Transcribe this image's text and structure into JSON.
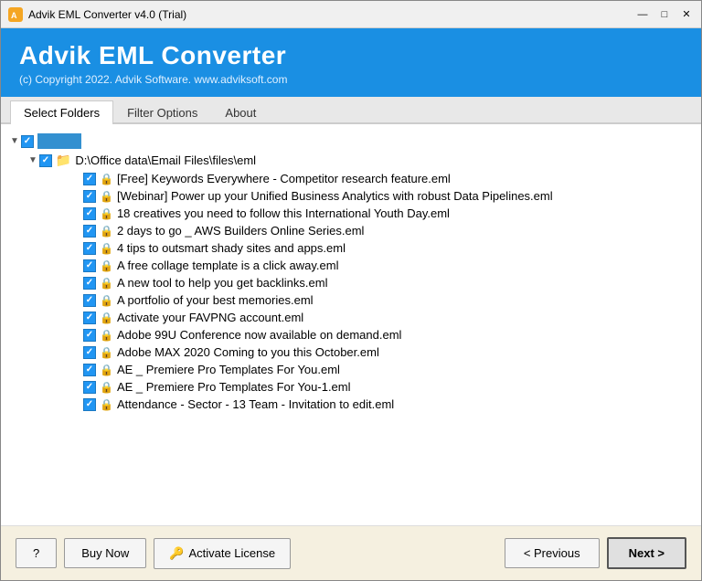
{
  "titleBar": {
    "title": "Advik EML Converter v4.0 (Trial)",
    "icon": "A",
    "minimizeLabel": "—",
    "maximizeLabel": "□",
    "closeLabel": "✕"
  },
  "header": {
    "title": "Advik EML Converter",
    "subtitle": "(c) Copyright 2022. Advik Software. www.adviksoft.com"
  },
  "tabs": [
    {
      "id": "select-folders",
      "label": "Select Folders",
      "active": true
    },
    {
      "id": "filter-options",
      "label": "Filter Options",
      "active": false
    },
    {
      "id": "about",
      "label": "About",
      "active": false
    }
  ],
  "tree": {
    "rootLabel": "",
    "folderPath": "D:\\Office data\\Email Files\\files\\eml",
    "files": [
      "[Free] Keywords Everywhere - Competitor research feature.eml",
      "[Webinar] Power up your Unified Business Analytics with robust Data Pipelines.eml",
      "18 creatives you need to follow this International Youth Day.eml",
      "2 days to go _ AWS Builders Online Series.eml",
      "4 tips to outsmart shady sites and apps.eml",
      "A free collage template is a click away.eml",
      "A new tool to help you get backlinks.eml",
      "A portfolio of your best memories.eml",
      "Activate your FAVPNG account.eml",
      "Adobe 99U Conference now available on demand.eml",
      "Adobe MAX 2020 Coming to you this October.eml",
      "AE _ Premiere Pro Templates For You.eml",
      "AE _ Premiere Pro Templates For You-1.eml",
      "Attendance - Sector - 13 Team - Invitation to edit.eml"
    ]
  },
  "footer": {
    "helpLabel": "?",
    "buyNowLabel": "Buy Now",
    "activateLabel": "Activate License",
    "keyIcon": "🔑",
    "previousLabel": "< Previous",
    "nextLabel": "Next >"
  }
}
